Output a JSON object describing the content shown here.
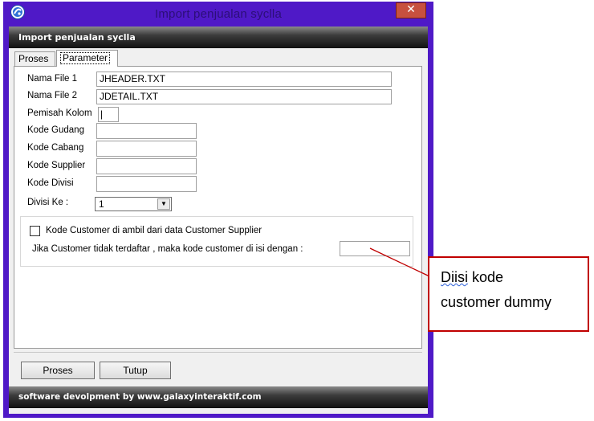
{
  "window": {
    "title": "Import penjualan syclla",
    "close_glyph": "✕",
    "icon": "galaxy-app-icon"
  },
  "banner": {
    "text": "Import penjualan syclla"
  },
  "tabs": [
    {
      "label": "Proses",
      "selected": false
    },
    {
      "label": "Parameter",
      "selected": true
    }
  ],
  "form": {
    "nama_file_1": {
      "label": "Nama File 1",
      "value": "JHEADER.TXT"
    },
    "nama_file_2": {
      "label": "Nama File 2",
      "value": "JDETAIL.TXT"
    },
    "pemisah_kolom": {
      "label": "Pemisah Kolom",
      "value": "|"
    },
    "kode_gudang": {
      "label": "Kode Gudang",
      "value": ""
    },
    "kode_cabang": {
      "label": "Kode Cabang",
      "value": ""
    },
    "kode_supplier": {
      "label": "Kode Supplier",
      "value": ""
    },
    "kode_divisi": {
      "label": "Kode Divisi",
      "value": ""
    },
    "divisi_ke": {
      "label": "Divisi Ke :",
      "value": "1"
    }
  },
  "customer_group": {
    "checkbox_label": "Kode Customer di ambil dari data Customer Supplier",
    "checked": false,
    "fallback_label": "Jika Customer tidak terdaftar , maka kode customer di isi dengan :",
    "fallback_value": ""
  },
  "buttons": {
    "proses": "Proses",
    "tutup": "Tutup"
  },
  "footer": {
    "text": "software devolpment by www.galaxyinteraktif.com"
  },
  "annotation": {
    "line1_word1": "Diisi",
    "line1_word2": "kode",
    "line2": "customer dummy",
    "color": "#c00000"
  }
}
